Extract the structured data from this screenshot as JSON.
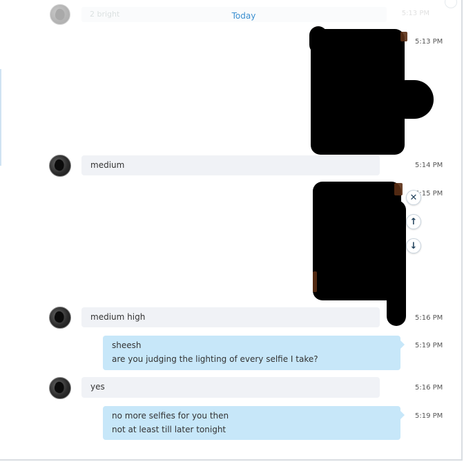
{
  "date_divider": "Today",
  "faded_top": {
    "text": "2 bright",
    "time": "5:13 PM"
  },
  "messages": [
    {
      "id": "m1",
      "direction": "out",
      "type": "image",
      "time": "5:13 PM"
    },
    {
      "id": "m2",
      "direction": "in",
      "type": "text",
      "lines": [
        "medium"
      ],
      "time": "5:14 PM"
    },
    {
      "id": "m3",
      "direction": "out",
      "type": "image",
      "time": "5:15 PM"
    },
    {
      "id": "m4",
      "direction": "in",
      "type": "text",
      "lines": [
        "medium high"
      ],
      "time": "5:16 PM"
    },
    {
      "id": "m5",
      "direction": "out",
      "type": "text",
      "lines": [
        "sheesh",
        "are you judging the lighting of every selfie I take?"
      ],
      "time": "5:19 PM"
    },
    {
      "id": "m6",
      "direction": "in",
      "type": "text",
      "lines": [
        "yes"
      ],
      "time": "5:16 PM"
    },
    {
      "id": "m7",
      "direction": "out",
      "type": "text",
      "lines": [
        "no more selfies for you then",
        "not at least till later tonight"
      ],
      "time": "5:19 PM"
    }
  ],
  "actions": [
    {
      "name": "close-icon",
      "glyph": "✕"
    },
    {
      "name": "jump-up-icon",
      "glyph": "↑"
    },
    {
      "name": "jump-down-icon",
      "glyph": "↓"
    }
  ],
  "colors": {
    "incoming_bubble": "#f0f2f6",
    "outgoing_bubble": "#c7e7f9",
    "accent": "#3a8fd0"
  }
}
